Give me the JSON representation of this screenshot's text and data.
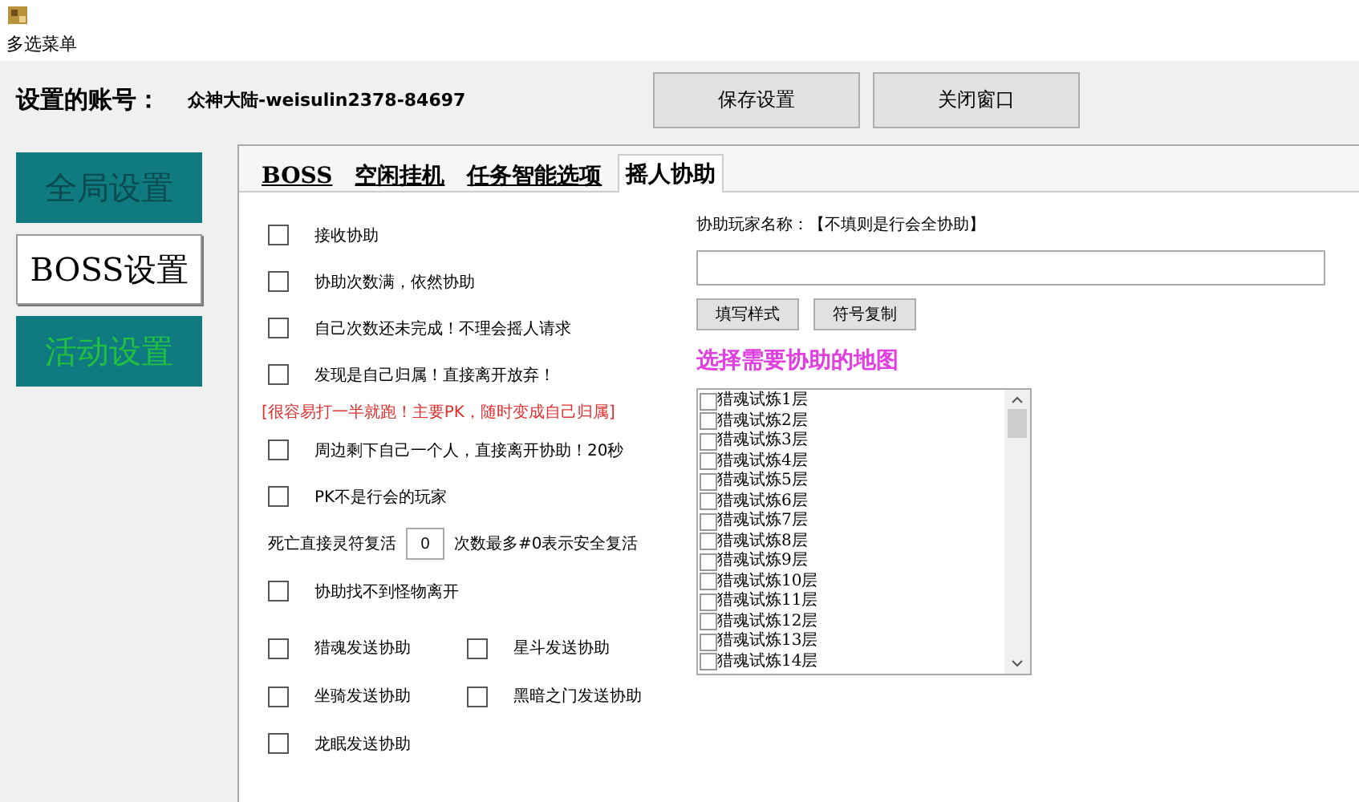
{
  "window": {
    "title": "多选菜单"
  },
  "account": {
    "label": "设置的账号：",
    "value": "众神大陆-weisulin2378-84697"
  },
  "top_buttons": [
    "保存设置",
    "关闭窗口"
  ],
  "sidebar": {
    "items": [
      {
        "label": "全局设置",
        "selected": false,
        "kind": "dim"
      },
      {
        "label": "BOSS设置",
        "selected": true,
        "kind": "plain"
      },
      {
        "label": "活动设置",
        "selected": false,
        "kind": "lit"
      }
    ]
  },
  "tabs": [
    {
      "label": "BOSS",
      "selected": false
    },
    {
      "label": "空闲挂机",
      "selected": false
    },
    {
      "label": "任务智能选项",
      "selected": false
    },
    {
      "label": "摇人协助",
      "selected": true
    }
  ],
  "options": [
    {
      "kind": "checkbox",
      "label": "接收协助",
      "checked": false
    },
    {
      "kind": "checkbox",
      "label": "协助次数满，依然协助",
      "checked": false
    },
    {
      "kind": "checkbox",
      "label": "自己次数还未完成！不理会摇人请求",
      "checked": false
    },
    {
      "kind": "checkbox",
      "label": "发现是自己归属！直接离开放弃！",
      "checked": false
    },
    {
      "kind": "note",
      "label": "[很容易打一半就跑！主要PK，随时变成自己归属]"
    },
    {
      "kind": "checkbox",
      "label": "周边剩下自己一个人，直接离开协助！20秒",
      "checked": false
    },
    {
      "kind": "checkbox",
      "label": "PK不是行会的玩家",
      "checked": false
    },
    {
      "kind": "number",
      "label": "死亡直接灵符复活",
      "value": "0",
      "hint": "次数最多#0表示安全复活"
    },
    {
      "kind": "checkbox",
      "label": "协助找不到怪物离开",
      "checked": false
    },
    {
      "kind": "pair",
      "items": [
        {
          "label": "猎魂发送协助",
          "checked": false
        },
        {
          "label": "星斗发送协助",
          "checked": false
        }
      ]
    },
    {
      "kind": "pair",
      "items": [
        {
          "label": "坐骑发送协助",
          "checked": false
        },
        {
          "label": "黑暗之门发送协助",
          "checked": false
        }
      ]
    },
    {
      "kind": "checkbox",
      "label": "龙眠发送协助",
      "checked": false
    }
  ],
  "assist": {
    "label": "协助玩家名称：【不填则是行会全协助】",
    "buttons": [
      "填写样式",
      "符号复制"
    ],
    "heading": "选择需要协助的地图",
    "maps": [
      {
        "label": "猎魂试炼1层",
        "checked": false
      },
      {
        "label": "猎魂试炼2层",
        "checked": false
      },
      {
        "label": "猎魂试炼3层",
        "checked": false
      },
      {
        "label": "猎魂试炼4层",
        "checked": false
      },
      {
        "label": "猎魂试炼5层",
        "checked": false
      },
      {
        "label": "猎魂试炼6层",
        "checked": false
      },
      {
        "label": "猎魂试炼7层",
        "checked": false
      },
      {
        "label": "猎魂试炼8层",
        "checked": false
      },
      {
        "label": "猎魂试炼9层",
        "checked": false
      },
      {
        "label": "猎魂试炼10层",
        "checked": false
      },
      {
        "label": "猎魂试炼11层",
        "checked": false
      },
      {
        "label": "猎魂试炼12层",
        "checked": false
      },
      {
        "label": "猎魂试炼13层",
        "checked": false
      },
      {
        "label": "猎魂试炼14层",
        "checked": false
      }
    ]
  }
}
